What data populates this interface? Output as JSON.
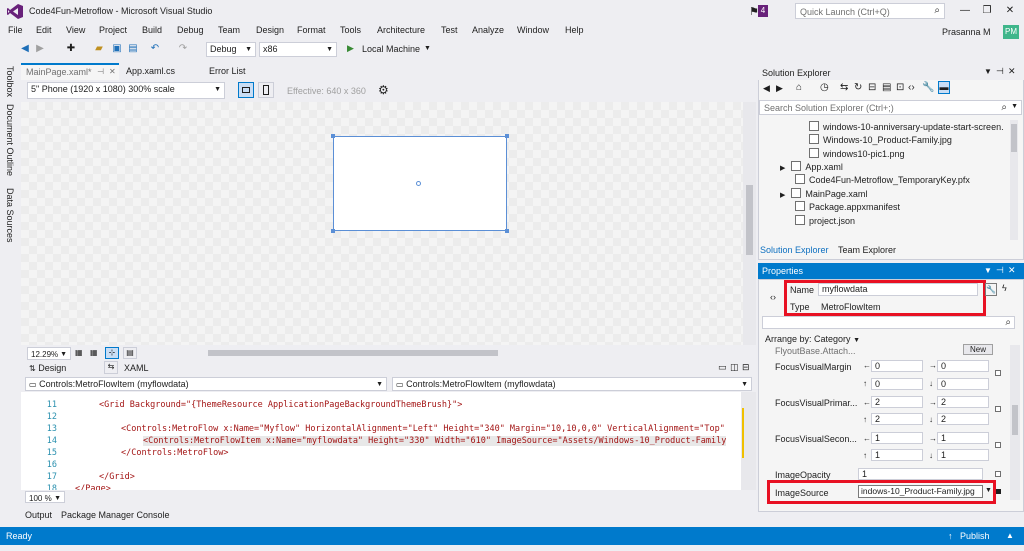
{
  "window": {
    "title": "Code4Fun-Metroflow - Microsoft Visual Studio",
    "notification_count": "4",
    "quick_launch_placeholder": "Quick Launch (Ctrl+Q)",
    "user_name": "Prasanna M",
    "user_initials": "PM"
  },
  "menu": [
    "File",
    "Edit",
    "View",
    "Project",
    "Build",
    "Debug",
    "Team",
    "Design",
    "Format",
    "Tools",
    "Architecture",
    "Test",
    "Analyze",
    "Window",
    "Help"
  ],
  "toolbar": {
    "config": "Debug",
    "platform": "x86",
    "run_target": "Local Machine"
  },
  "side_tabs": [
    "Toolbox",
    "Document Outline",
    "Data Sources"
  ],
  "doc_tabs": [
    "MainPage.xaml*",
    "App.xaml.cs",
    "Error List"
  ],
  "designer": {
    "device": "5\" Phone (1920 x 1080) 300% scale",
    "effective": "Effective: 640 x 360",
    "zoom": "12.29%"
  },
  "view_tabs": {
    "design": "Design",
    "xaml": "XAML"
  },
  "code_nav": {
    "left": "Controls:MetroFlowItem (myflowdata)",
    "right": "Controls:MetroFlowItem (myflowdata)"
  },
  "code_lines": [
    {
      "n": "11",
      "text": "<Grid Background=\"{ThemeResource ApplicationPageBackgroundThemeBrush}\">"
    },
    {
      "n": "12",
      "text": ""
    },
    {
      "n": "13",
      "text": "<Controls:MetroFlow x:Name=\"Myflow\" HorizontalAlignment=\"Left\" Height=\"340\" Margin=\"10,10,0,0\" VerticalAlignment=\"Top\""
    },
    {
      "n": "14",
      "text": "<Controls:MetroFlowItem x:Name=\"myflowdata\" Height=\"330\" Width=\"610\" ImageSource=\"Assets/Windows-10_Product-Family"
    },
    {
      "n": "15",
      "text": "</Controls:MetroFlow>"
    },
    {
      "n": "16",
      "text": ""
    },
    {
      "n": "17",
      "text": "</Grid>"
    },
    {
      "n": "18",
      "text": "</Page>"
    }
  ],
  "code_zoom": "100 %",
  "bottom_tabs": [
    "Output",
    "Package Manager Console"
  ],
  "status": {
    "text": "Ready",
    "publish": "Publish"
  },
  "solution_explorer": {
    "title": "Solution Explorer",
    "search_placeholder": "Search Solution Explorer (Ctrl+;)",
    "items": [
      {
        "label": "windows-10-anniversary-update-start-screen.",
        "indent": 2
      },
      {
        "label": "Windows-10_Product-Family.jpg",
        "indent": 2
      },
      {
        "label": "windows10-pic1.png",
        "indent": 2
      },
      {
        "label": "App.xaml",
        "indent": 1,
        "expandable": true
      },
      {
        "label": "Code4Fun-Metroflow_TemporaryKey.pfx",
        "indent": 1
      },
      {
        "label": "MainPage.xaml",
        "indent": 1,
        "expandable": true
      },
      {
        "label": "Package.appxmanifest",
        "indent": 1
      },
      {
        "label": "project.json",
        "indent": 1
      }
    ],
    "tabs": [
      "Solution Explorer",
      "Team Explorer"
    ]
  },
  "properties": {
    "title": "Properties",
    "name_label": "Name",
    "name_value": "myflowdata",
    "type_label": "Type",
    "type_value": "MetroFlowItem",
    "arrange_by": "Arrange by: Category",
    "flyout_label": "FlyoutBase.Attach...",
    "new_button": "New",
    "rows": [
      {
        "label": "FocusVisualMargin",
        "values": [
          "0",
          "0",
          "0",
          "0"
        ]
      },
      {
        "label": "FocusVisualPrimar...",
        "values": [
          "2",
          "2",
          "2",
          "2"
        ]
      },
      {
        "label": "FocusVisualSecon...",
        "values": [
          "1",
          "1",
          "1",
          "1"
        ]
      }
    ],
    "image_opacity_label": "ImageOpacity",
    "image_opacity_value": "1",
    "image_source_label": "ImageSource",
    "image_source_value": "indows-10_Product-Family.jpg"
  },
  "colors": {
    "accent": "#007acc",
    "highlight_box": "#e81123",
    "avatar": "#3fb68b",
    "badge": "#68217a"
  }
}
